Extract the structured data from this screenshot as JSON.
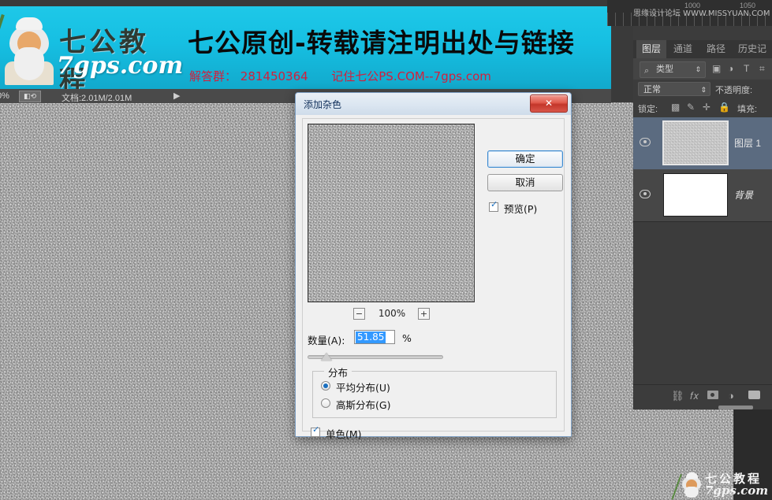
{
  "app": {
    "name": "Adobe Photoshop",
    "canvas_bg": "#f2f2f2",
    "chrome_bg": "#3a3a3a"
  },
  "banner": {
    "logo_cn": "七公教程",
    "logo_en": "7gps.com",
    "headline": "七公原创-转载请注明出处与链接",
    "sub_prefix": "解答群：",
    "qq_group": "281450364",
    "sub_suffix": "记住七公PS.COM--7gps.com",
    "bg_color": "#16bfe2",
    "headline_color": "#0a0a0a",
    "sub_color": "#d21f3c"
  },
  "status_bar": {
    "zoom": "0%",
    "proxy_icon": "document-icon",
    "doc_label": "文档:2.01M/2.01M",
    "expand_icon": "▶"
  },
  "ruler": {
    "mark1": "1000",
    "mark2": "1050",
    "watermark": "思缘设计论坛 WWW.MISSYUAN.COM"
  },
  "layers_panel": {
    "tabs": [
      {
        "label": "图层",
        "active": true
      },
      {
        "label": "通道",
        "active": false
      },
      {
        "label": "路径",
        "active": false
      },
      {
        "label": "历史记录",
        "active": false
      }
    ],
    "filter": {
      "search_icon": "search-icon",
      "type_label": "类型",
      "arrow": "⇕",
      "icons": [
        "image-filter-icon",
        "adjustment-filter-icon",
        "text-filter-icon",
        "shape-filter-icon"
      ]
    },
    "blend_mode": "正常",
    "blend_arrow": "⇕",
    "opacity_label": "不透明度:",
    "lock_label": "锁定:",
    "lock_icons": [
      "transparency-lock-icon",
      "brush-lock-icon",
      "move-lock-icon",
      "all-lock-icon"
    ],
    "fill_label": "填充:",
    "layers": [
      {
        "name": "图层 1",
        "visible": true,
        "selected": true,
        "thumb": "noise",
        "italic": false
      },
      {
        "name": "背景",
        "visible": true,
        "selected": false,
        "thumb": "white",
        "italic": true
      }
    ],
    "bottom_icons": [
      "link-icon",
      "fx-icon",
      "mask-icon",
      "adjustment-icon",
      "group-folder-icon"
    ],
    "selected_color": "#5b6b80"
  },
  "dialog": {
    "title": "添加杂色",
    "close_label": "✕",
    "ok_label": "确定",
    "cancel_label": "取消",
    "preview_label": "预览(P)",
    "preview_checked": true,
    "preview_check_glyph": "✓",
    "zoom": {
      "minus_label": "−",
      "value": "100%",
      "plus_label": "+"
    },
    "amount": {
      "label": "数量(A):",
      "value": "51.85",
      "unit": "%",
      "selected": true,
      "selection_color": "#3399ff",
      "slider_percent": 10
    },
    "distribution": {
      "legend": "分布",
      "options": [
        {
          "label": "平均分布(U)",
          "selected": true
        },
        {
          "label": "高斯分布(G)",
          "selected": false
        }
      ]
    },
    "monochrome": {
      "label": "单色(M)",
      "checked": true,
      "check_glyph": "✓"
    },
    "accent_color": "#3c8ad0"
  },
  "watermark": {
    "cn": "七公教程",
    "en": "7gps.com"
  }
}
